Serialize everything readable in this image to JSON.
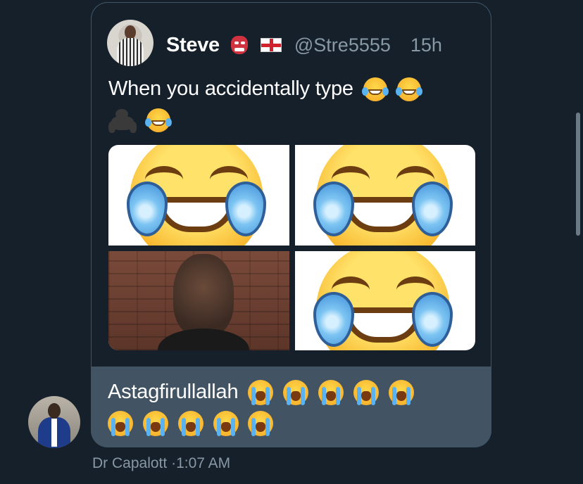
{
  "quoted_tweet": {
    "name": "Steve",
    "name_emojis": [
      "ogre-emoji",
      "england-flag-emoji"
    ],
    "handle": "@Stre5555",
    "time": "15h",
    "text": "When you accidentally type",
    "text_emojis": [
      "laughing-tears-emoji",
      "laughing-tears-emoji",
      "gorilla-emoji",
      "laughing-tears-emoji"
    ],
    "images": [
      "laughing-tears-emoji-image",
      "laughing-tears-emoji-image",
      "photo-of-man",
      "laughing-tears-emoji-image"
    ]
  },
  "message": {
    "text": "Astagfirullallah",
    "emojis": [
      "crying-emoji",
      "crying-emoji",
      "crying-emoji",
      "crying-emoji",
      "crying-emoji",
      "crying-emoji",
      "crying-emoji",
      "crying-emoji",
      "crying-emoji",
      "crying-emoji"
    ],
    "sender": "Dr Capalott",
    "separator": "·",
    "time": "1:07 AM"
  },
  "colors": {
    "background": "#15202b",
    "bubble": "#425463",
    "secondary_text": "#8899a6"
  }
}
